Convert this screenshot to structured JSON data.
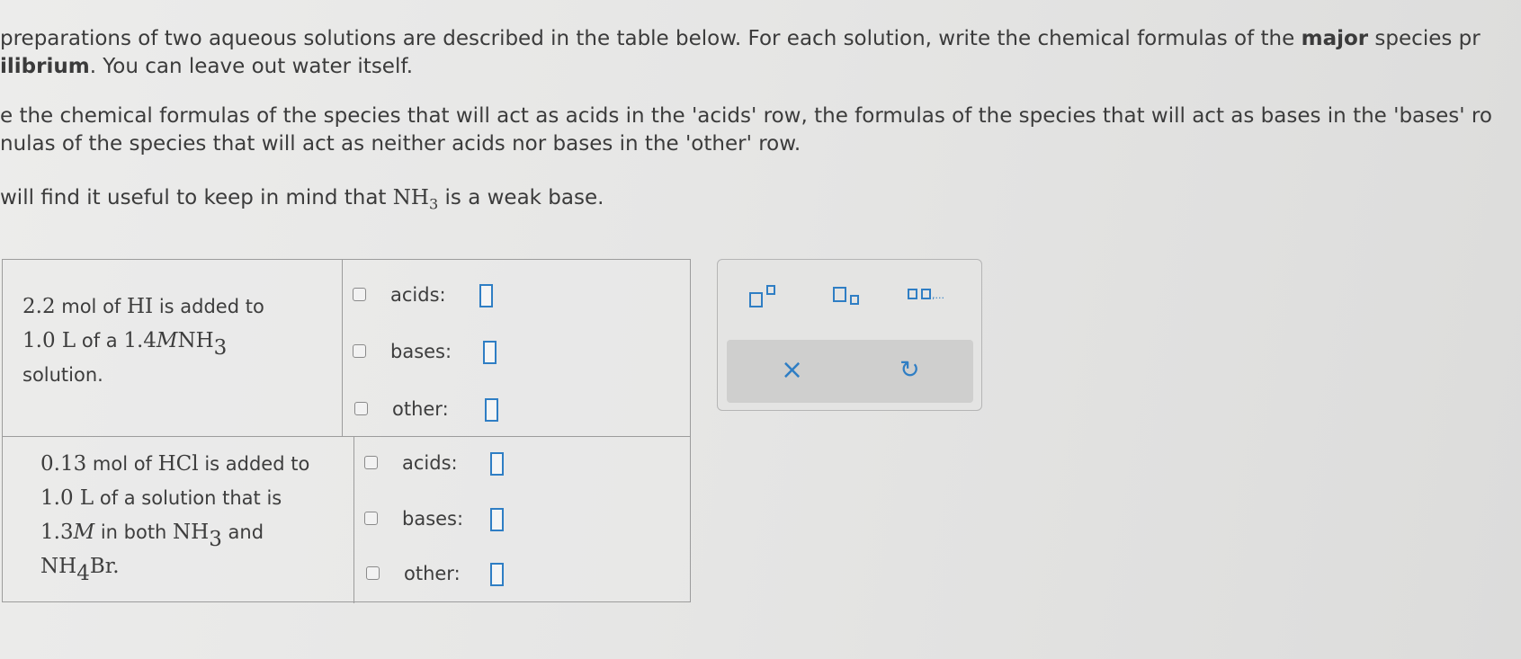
{
  "instructions": {
    "p1_line1_a": "preparations of two aqueous solutions are described in the table below. For each solution, write the chemical formulas of the ",
    "p1_line1_bold": "major",
    "p1_line1_b": " species pr",
    "p1_line2_bold": "ilibrium",
    "p1_line2_rest": ". You can leave out water itself.",
    "p2_line1": "e the chemical formulas of the species that will act as acids in the 'acids' row, the formulas of the species that will act as bases in the 'bases' ro",
    "p2_line2": "nulas of the species that will act as neither acids nor bases in the 'other' row.",
    "p3_before": "will find it useful to keep in mind that ",
    "p3_formula": "NH",
    "p3_sub": "3",
    "p3_after": " is a weak base."
  },
  "table": {
    "row1": {
      "line1_num": "2.2",
      "line1_text": " mol of ",
      "line1_formula": "HI",
      "line1_end": " is added to",
      "line2_num": "1.0 L",
      "line2_text": " of a ",
      "line2_conc": "1.4",
      "line2_unit": "M",
      "line2_formula": "NH",
      "line2_sub": "3",
      "line3": "solution.",
      "acids_label": "acids:",
      "bases_label": "bases:",
      "other_label": "other:"
    },
    "row2": {
      "line1_num": "0.13",
      "line1_text": " mol of ",
      "line1_formula": "HCl",
      "line1_end": " is added to",
      "line2_num": "1.0 L",
      "line2_text": " of a solution that is",
      "line3_conc": "1.3",
      "line3_unit": "M",
      "line3_text": " in both ",
      "line3_formula": "NH",
      "line3_sub": "3",
      "line3_end": " and",
      "line4_formula": "NH",
      "line4_sub": "4",
      "line4_end": "Br.",
      "acids_label": "acids:",
      "bases_label": "bases:",
      "other_label": "other:"
    }
  },
  "toolbar": {
    "list_dots": ",...",
    "clear_symbol": "×",
    "undo_symbol": "↻"
  },
  "colors": {
    "accent": "#2f7ec4",
    "text": "#3b3b3b",
    "border": "#9c9c9c"
  }
}
